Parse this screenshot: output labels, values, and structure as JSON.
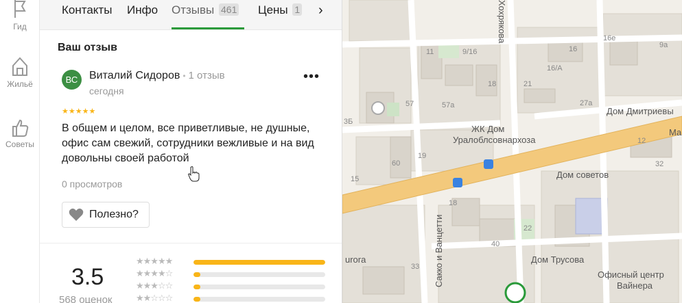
{
  "rail": {
    "items": [
      {
        "label": "Гид",
        "icon": "flag-icon"
      },
      {
        "label": "Жильё",
        "icon": "house-icon"
      },
      {
        "label": "Советы",
        "icon": "thumbs-up-icon"
      }
    ]
  },
  "tabs": {
    "contacts": "Контакты",
    "info": "Инфо",
    "reviews": "Отзывы",
    "reviews_count": "461",
    "prices": "Цены",
    "prices_count": "1",
    "next": "›"
  },
  "review": {
    "section_title": "Ваш отзыв",
    "avatar_initials": "ВС",
    "author": "Виталий Сидоров",
    "author_reviews": "1 отзыв",
    "date": "сегодня",
    "more": "•••",
    "stars": "★★★★★",
    "text": "В общем и целом, все приветливые, не душные, офис сам свежий, сотрудники вежливые и на вид довольны своей работой",
    "views": "0 просмотров",
    "useful": "Полезно?"
  },
  "rating": {
    "value": "3.5",
    "count": "568 оценок",
    "distribution": [
      {
        "stars": 5,
        "fraction": 1.0
      },
      {
        "stars": 4,
        "fraction": 0.05
      },
      {
        "stars": 3,
        "fraction": 0.05
      },
      {
        "stars": 2,
        "fraction": 0.05
      }
    ]
  },
  "map": {
    "labels": {
      "khokhryakova": "Хохрякова",
      "zhk": "ЖК Дом",
      "uralobl": "Уралоблсовнархоза",
      "dom_sovetov": "Дом советов",
      "dom_dmitrievy": "Дом Дмитриевы",
      "sakko": "Сакко и Ванцетти",
      "dom_trusova": "Дом Трусова",
      "ofis": "Офисный центр",
      "vainera": "Вайнера",
      "aurora": "urora",
      "ma": "Ма"
    },
    "numbers": [
      "11",
      "9/16",
      "16",
      "16e",
      "9a",
      "16/A",
      "21",
      "27a",
      "18",
      "57",
      "57a",
      "19",
      "60",
      "15",
      "18",
      "40",
      "33",
      "22",
      "3Б",
      "12",
      "32"
    ]
  }
}
